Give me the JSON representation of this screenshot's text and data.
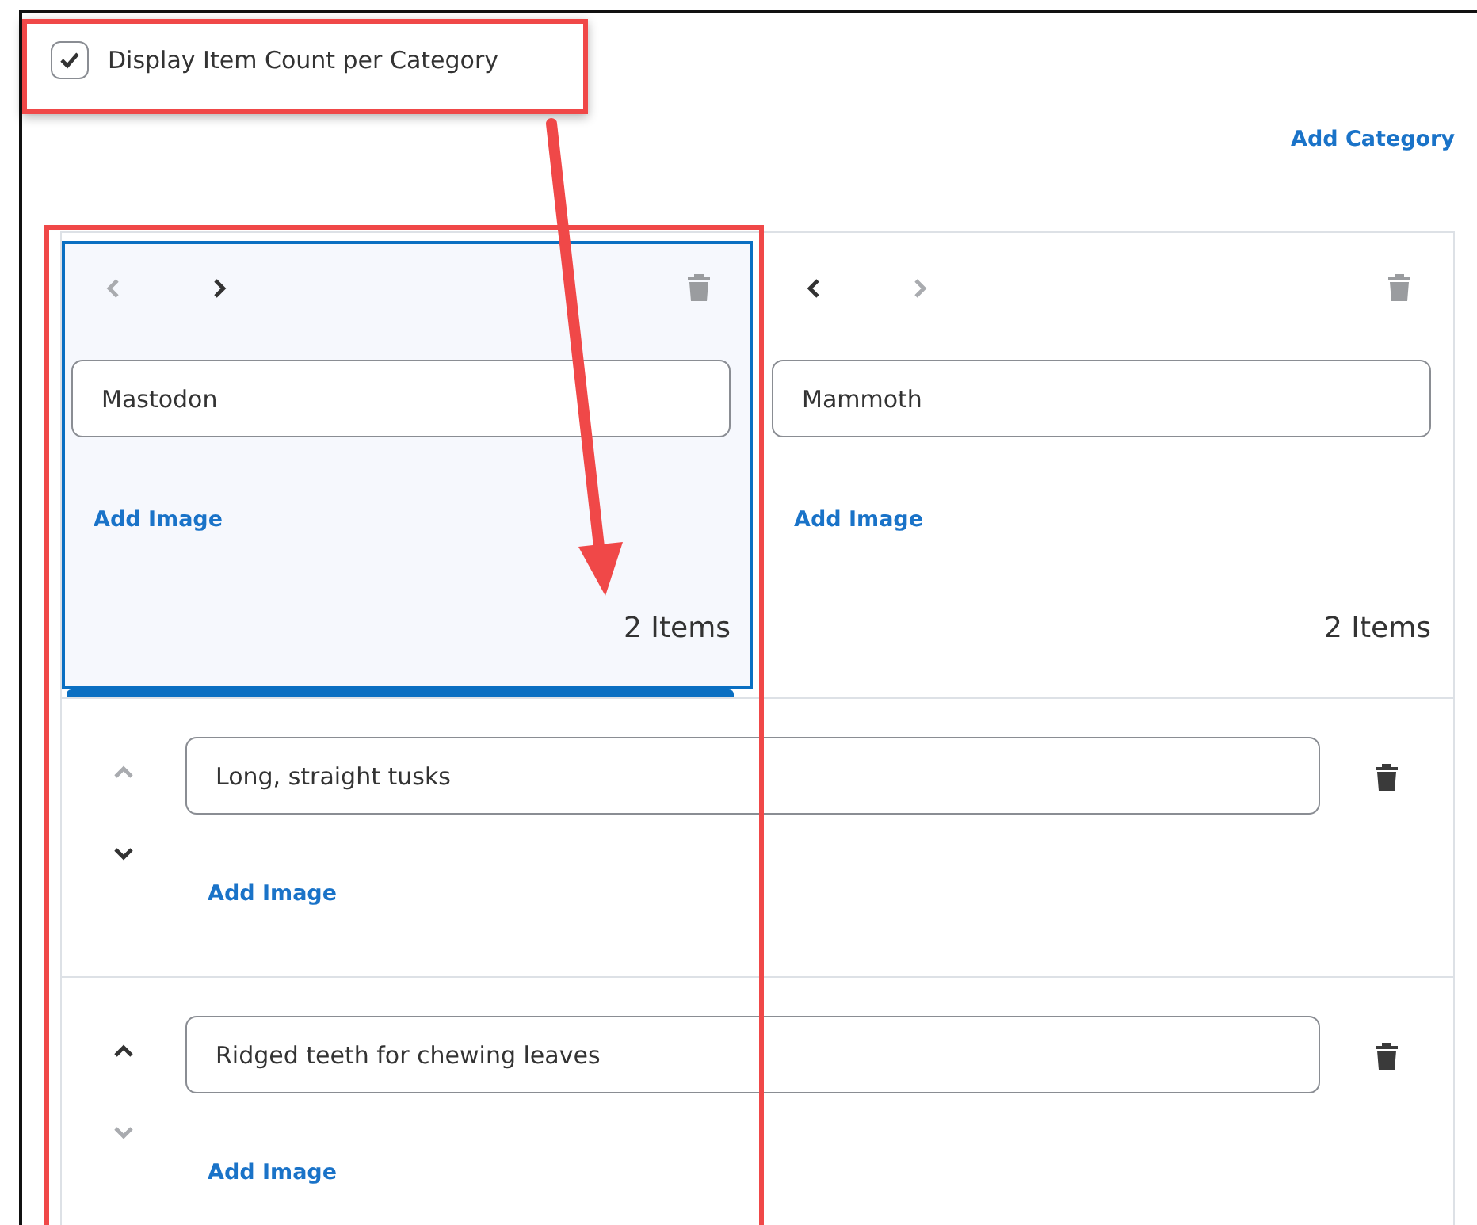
{
  "display_count": {
    "label": "Display Item Count per Category",
    "checked": true
  },
  "add_category": "Add Category",
  "categories": [
    {
      "name": "Mastodon",
      "selected": true,
      "prev_enabled": false,
      "next_enabled": true,
      "add_image": "Add Image",
      "count": "2 Items"
    },
    {
      "name": "Mammoth",
      "selected": false,
      "prev_enabled": true,
      "next_enabled": false,
      "add_image": "Add Image",
      "count": "2 Items"
    }
  ],
  "items": [
    {
      "text": "Long, straight tusks",
      "up_enabled": false,
      "down_enabled": true,
      "add_image": "Add Image"
    },
    {
      "text": "Ridged teeth for chewing leaves",
      "up_enabled": true,
      "down_enabled": false,
      "add_image": "Add Image"
    }
  ]
}
